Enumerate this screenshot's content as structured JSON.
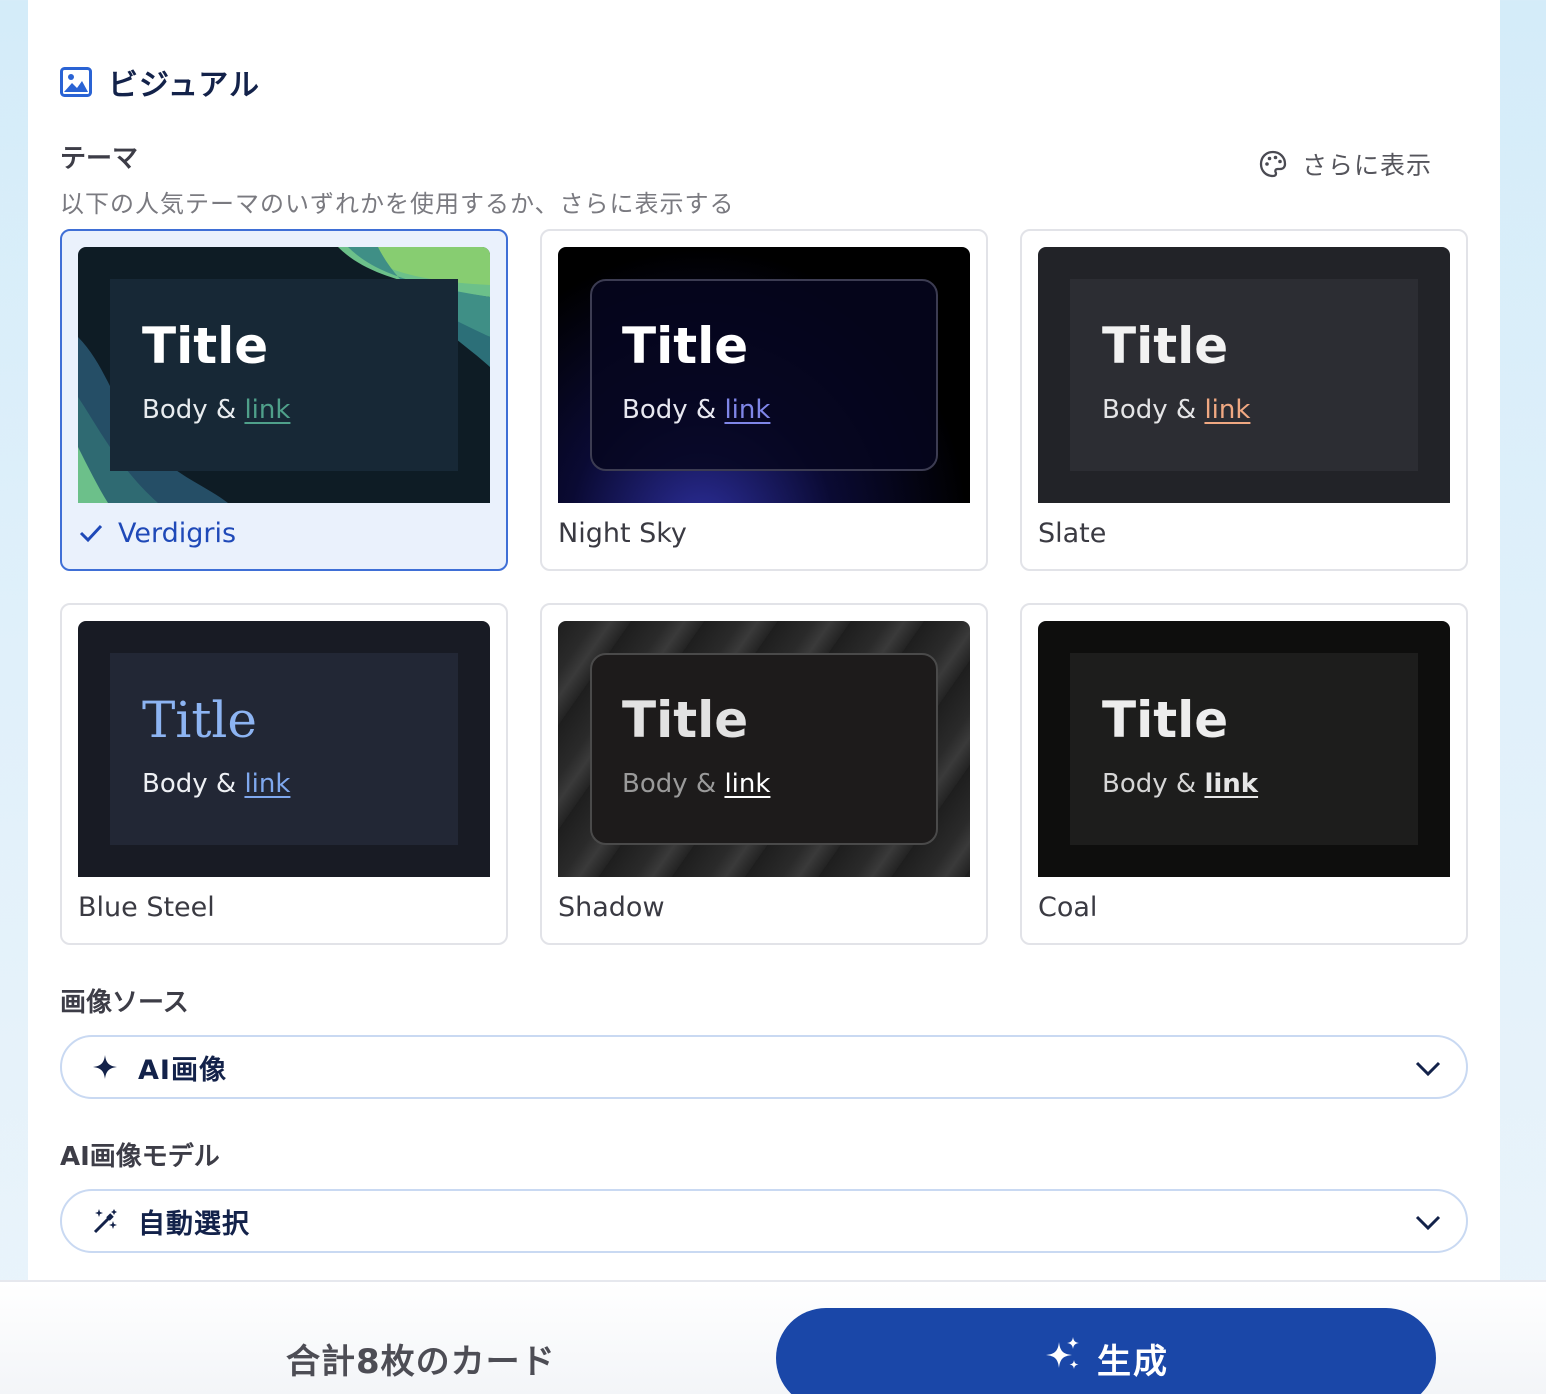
{
  "visual_section": {
    "title": "ビジュアル",
    "icon": "image-icon"
  },
  "theme": {
    "label": "テーマ",
    "subtitle": "以下の人気テーマのいずれかを使用するか、さらに表示する",
    "more_label": "さらに表示",
    "more_icon": "palette-icon",
    "cards": [
      {
        "name": "Verdigris",
        "title": "Title",
        "body": "Body &",
        "link": "link",
        "selected": true,
        "link_color": "#4fa08a"
      },
      {
        "name": "Night Sky",
        "title": "Title",
        "body": "Body &",
        "link": "link",
        "selected": false,
        "link_color": "#7f86e8"
      },
      {
        "name": "Slate",
        "title": "Title",
        "body": "Body &",
        "link": "link",
        "selected": false,
        "link_color": "#f0a882"
      },
      {
        "name": "Blue Steel",
        "title": "Title",
        "body": "Body &",
        "link": "link",
        "selected": false,
        "link_color": "#7fa8ee"
      },
      {
        "name": "Shadow",
        "title": "Title",
        "body": "Body &",
        "link": "link",
        "selected": false,
        "link_color": "#ffffff"
      },
      {
        "name": "Coal",
        "title": "Title",
        "body": "Body &",
        "link": "link",
        "selected": false,
        "link_color": "#e6e6e6"
      }
    ]
  },
  "image_source": {
    "label": "画像ソース",
    "value": "AI画像",
    "icon": "sparkle-icon"
  },
  "ai_model": {
    "label": "AI画像モデル",
    "value": "自動選択",
    "icon": "magic-wand-icon"
  },
  "footer": {
    "card_count": "合計8枚のカード",
    "generate_label": "生成",
    "generate_icon": "sparkles-icon"
  },
  "colors": {
    "accent": "#1a47a8",
    "selected_border": "#3f6fd6",
    "selected_bg": "#eaf1fc"
  }
}
